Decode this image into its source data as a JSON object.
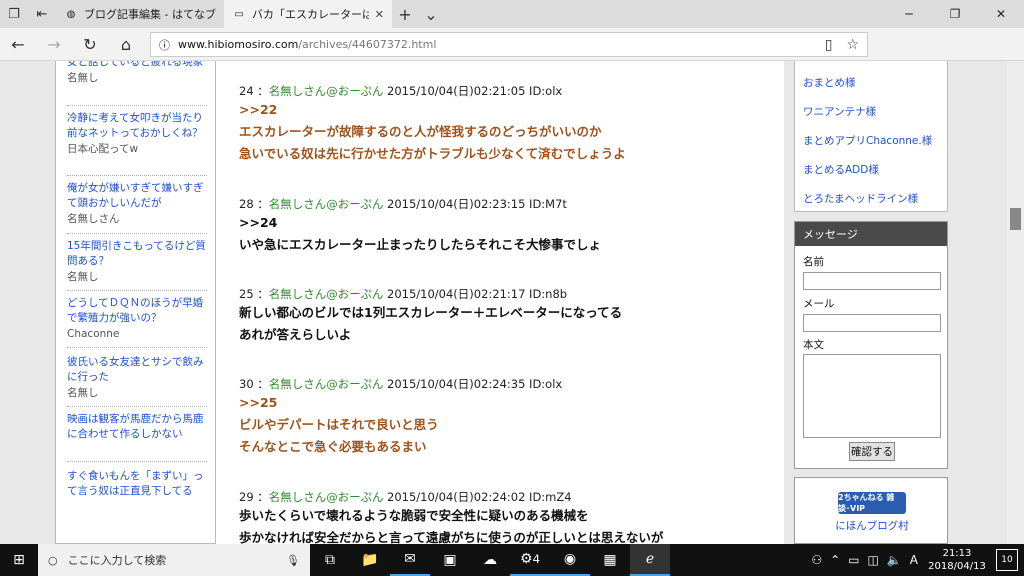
{
  "browser": {
    "tabs": [
      {
        "title": "ブログ記事編集 - はてなブログ",
        "favicon": "hatena-icon"
      },
      {
        "title": "バカ「エスカレーターは歩くな",
        "favicon": "page-icon",
        "active": true
      }
    ],
    "url_domain": "www.hibiomosiro.com",
    "url_path": "/archives/44607372.html"
  },
  "left_sidebar": {
    "items": [
      {
        "title": "女と話していると疲れる現象",
        "source": "名無し"
      },
      {
        "title": "冷静に考えて女叩きが当たり前なネットっておかしくね？",
        "source": "日本心配ってw"
      },
      {
        "title": "俺が女が嫌いすぎて嫌いすぎて頭おかしいんだが",
        "source": "名無しさん"
      },
      {
        "title": "15年間引きこもってるけど質問ある？",
        "source": "名無し"
      },
      {
        "title": "どうしてＤＱＮのほうが早婚で繁殖力が強いの？",
        "source": "Chaconne"
      },
      {
        "title": "彼氏いる女友達とサシで飲みに行った",
        "source": "名無し"
      },
      {
        "title": "映画は観客が馬鹿だから馬鹿に合わせて作るしかない",
        "source": ""
      },
      {
        "title": "すぐ食いもんを「まずい」って言う奴は正直見下してる",
        "source": ""
      }
    ]
  },
  "posts": [
    {
      "num": "24",
      "name": "名無しさん@おーぷん",
      "date": "2015/10/04(日)02:21:05 ID:olx",
      "color": "brown",
      "lines": [
        ">>22",
        "エスカレーターが故障するのと人が怪我するのどっちがいいのか",
        "急いでいる奴は先に行かせた方がトラブルも少なくて済むでしょうよ"
      ]
    },
    {
      "num": "28",
      "name": "名無しさん@おーぷん",
      "date": "2015/10/04(日)02:23:15 ID:M7t",
      "color": "black",
      "lines": [
        ">>24",
        "いや急にエスカレーター止まったりしたらそれこそ大惨事でしょ"
      ]
    },
    {
      "num": "25",
      "name": "名無しさん@おーぷん",
      "date": "2015/10/04(日)02:21:17 ID:n8b",
      "color": "black",
      "lines": [
        "新しい都心のビルでは1列エスカレーター＋エレベーターになってる",
        "あれが答えらしいよ"
      ]
    },
    {
      "num": "30",
      "name": "名無しさん@おーぷん",
      "date": "2015/10/04(日)02:24:35 ID:olx",
      "color": "brown",
      "lines": [
        ">>25",
        "ビルやデパートはそれで良いと思う",
        "そんなとこで急ぐ必要もあるまい"
      ]
    },
    {
      "num": "29",
      "name": "名無しさん@おーぷん",
      "date": "2015/10/04(日)02:24:02 ID:mZ4",
      "color": "black",
      "lines": [
        "歩いたくらいで壊れるような脆弱で安全性に疑いのある機械を",
        "歩かなければ安全だからと言って遠慮がちに使うのが正しいとは思えないが"
      ]
    }
  ],
  "right_sidebar": {
    "links": [
      "おまとめ様",
      "ワニアンテナ様",
      "まとめアプリChaconne.様",
      "まとめるADD様",
      "とろたまヘッドライン様"
    ],
    "message_title": "メッセージ",
    "name_label": "名前",
    "mail_label": "メール",
    "body_label": "本文",
    "submit_label": "確認する",
    "banner_text": "2ちゃんねる 雑談･VIP",
    "banner_link": "にほんブログ村"
  },
  "taskbar": {
    "search_placeholder": "ここに入力して検索",
    "time": "21:13",
    "date": "2018/04/13",
    "notif_count": "10",
    "badge": "4"
  }
}
